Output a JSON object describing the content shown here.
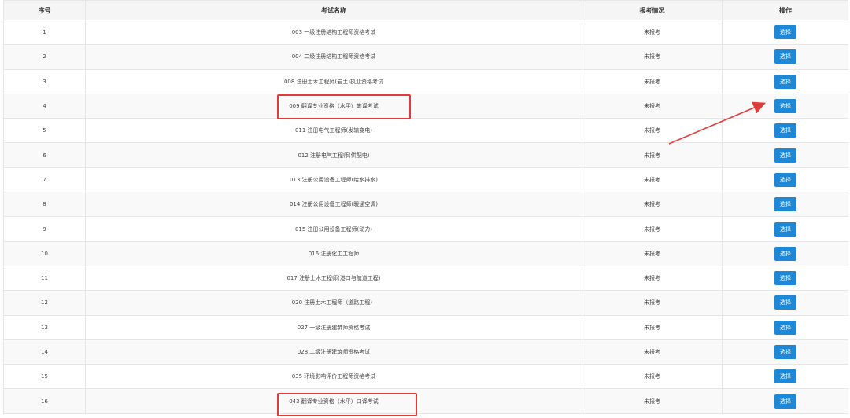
{
  "table": {
    "headers": {
      "seq": "序号",
      "name": "考试名称",
      "status": "报考情况",
      "operation": "操作"
    },
    "rows": [
      {
        "seq": "1",
        "name": "003 一级注册结构工程师资格考试",
        "status": "未报考",
        "button": "选择"
      },
      {
        "seq": "2",
        "name": "004 二级注册结构工程师资格考试",
        "status": "未报考",
        "button": "选择"
      },
      {
        "seq": "3",
        "name": "008 注册土木工程师(岩土)执业资格考试",
        "status": "未报考",
        "button": "选择"
      },
      {
        "seq": "4",
        "name": "009 翻译专业资格（水平）笔译考试",
        "status": "未报考",
        "button": "选择"
      },
      {
        "seq": "5",
        "name": "011 注册电气工程师(发输变电)",
        "status": "未报考",
        "button": "选择"
      },
      {
        "seq": "6",
        "name": "012 注册电气工程师(供配电)",
        "status": "未报考",
        "button": "选择"
      },
      {
        "seq": "7",
        "name": "013 注册公用设备工程师(给水排水)",
        "status": "未报考",
        "button": "选择"
      },
      {
        "seq": "8",
        "name": "014 注册公用设备工程师(暖通空调)",
        "status": "未报考",
        "button": "选择"
      },
      {
        "seq": "9",
        "name": "015 注册公用设备工程师(动力)",
        "status": "未报考",
        "button": "选择"
      },
      {
        "seq": "10",
        "name": "016 注册化工工程师",
        "status": "未报考",
        "button": "选择"
      },
      {
        "seq": "11",
        "name": "017 注册土木工程师(港口与航道工程)",
        "status": "未报考",
        "button": "选择"
      },
      {
        "seq": "12",
        "name": "020 注册土木工程师（道路工程）",
        "status": "未报考",
        "button": "选择"
      },
      {
        "seq": "13",
        "name": "027 一级注册建筑师资格考试",
        "status": "未报考",
        "button": "选择"
      },
      {
        "seq": "14",
        "name": "028 二级注册建筑师资格考试",
        "status": "未报考",
        "button": "选择"
      },
      {
        "seq": "15",
        "name": "035 环境影响评价工程师资格考试",
        "status": "未报考",
        "button": "选择"
      },
      {
        "seq": "16",
        "name": "043 翻译专业资格（水平）口译考试",
        "status": "未报考",
        "button": "选择"
      }
    ]
  },
  "colors": {
    "button": "#1e88d6",
    "highlight": "#e33a3a"
  }
}
